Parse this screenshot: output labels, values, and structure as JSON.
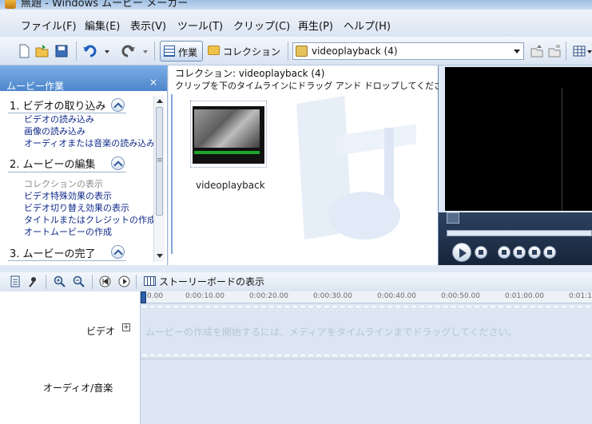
{
  "window": {
    "title": "無題 - Windows ムービー メーカー"
  },
  "menu": [
    "ファイル(F)",
    "編集(E)",
    "表示(V)",
    "ツール(T)",
    "クリップ(C)",
    "再生(P)",
    "ヘルプ(H)"
  ],
  "toolbar": {
    "tasks_label": "作業",
    "collection_label": "コレクション",
    "collection_select": "videoplayback (4)"
  },
  "taskpane": {
    "title": "ムービー作業",
    "close": "×",
    "sections": [
      {
        "heading": "1. ビデオの取り込み",
        "links": [
          "ビデオの読み込み",
          "画像の読み込み",
          "オーディオまたは音楽の読み込み"
        ]
      },
      {
        "heading": "2. ムービーの編集",
        "links": [
          "コレクションの表示",
          "ビデオ特殊効果の表示",
          "ビデオ切り替え効果の表示",
          "タイトルまたはクレジットの作成",
          "オートムービーの作成"
        ]
      },
      {
        "heading": "3. ムービーの完了",
        "links": []
      }
    ]
  },
  "collection": {
    "title": "コレクション: videoplayback (4)",
    "subtitle": "クリップを下のタイムラインにドラッグ アンド ドロップしてください。",
    "clips": [
      {
        "name": "videoplayback"
      }
    ]
  },
  "timeline": {
    "storyboard_label": "ストーリーボードの表示",
    "ruler": [
      "0.00",
      "0:00:10.00",
      "0:00:20.00",
      "0:00:30.00",
      "0:00:40.00",
      "0:00:50.00",
      "0:01:00.00",
      "0:01:1"
    ],
    "tracks": {
      "video_label": "ビデオ",
      "video_expand": "⊞",
      "video_hint": "ムービーの作成を開始するには、メディアをタイムラインまでドラッグしてください。",
      "audio_label": "オーディオ/音楽"
    }
  }
}
